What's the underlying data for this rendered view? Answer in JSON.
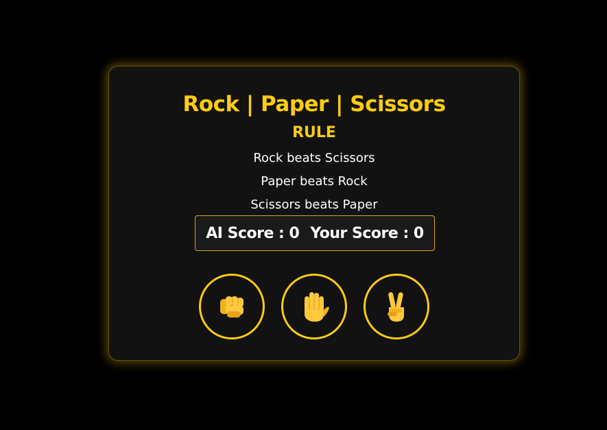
{
  "game": {
    "title": "Rock | Paper | Scissors",
    "rule_heading": "RULE",
    "rules": [
      "Rock beats Scissors",
      "Paper beats Rock",
      "Scissors beats Paper"
    ]
  },
  "score": {
    "ai_label": "AI Score : ",
    "ai_value": "0",
    "user_label": "Your Score : ",
    "user_value": "0"
  },
  "choices": [
    {
      "name": "rock",
      "icon": "fist-icon"
    },
    {
      "name": "paper",
      "icon": "raised-hand-icon"
    },
    {
      "name": "scissors",
      "icon": "victory-hand-icon"
    }
  ],
  "colors": {
    "accent": "#ffcc11",
    "background": "#000000",
    "card": "#121212",
    "text": "#ffffff"
  }
}
